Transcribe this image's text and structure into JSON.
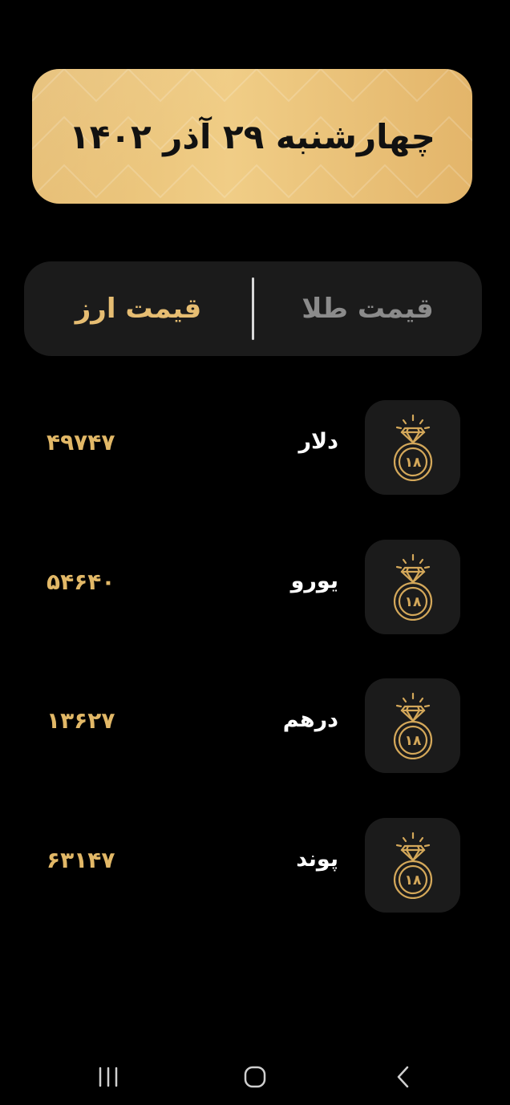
{
  "banner": {
    "date": "چهارشنبه ۲۹ آذر ۱۴۰۲"
  },
  "tabs": {
    "gold": "قیمت طلا",
    "currency": "قیمت ارز",
    "active": "currency"
  },
  "rows": [
    {
      "name": "دلار",
      "value": "۴۹۷۴۷",
      "icon": "gold-ring-18k-icon"
    },
    {
      "name": "یورو",
      "value": "۵۴۶۴۰",
      "icon": "gold-ring-18k-icon"
    },
    {
      "name": "درهم",
      "value": "۱۳۶۲۷",
      "icon": "gold-ring-18k-icon"
    },
    {
      "name": "پوند",
      "value": "۶۳۱۴۷",
      "icon": "gold-ring-18k-icon"
    }
  ],
  "ring_badge": "۱۸",
  "colors": {
    "accent": "#e6bd72",
    "background": "#000000",
    "card": "#1b1b1b"
  },
  "navbar": {
    "icons": [
      "recents-icon",
      "home-icon",
      "back-icon"
    ]
  }
}
